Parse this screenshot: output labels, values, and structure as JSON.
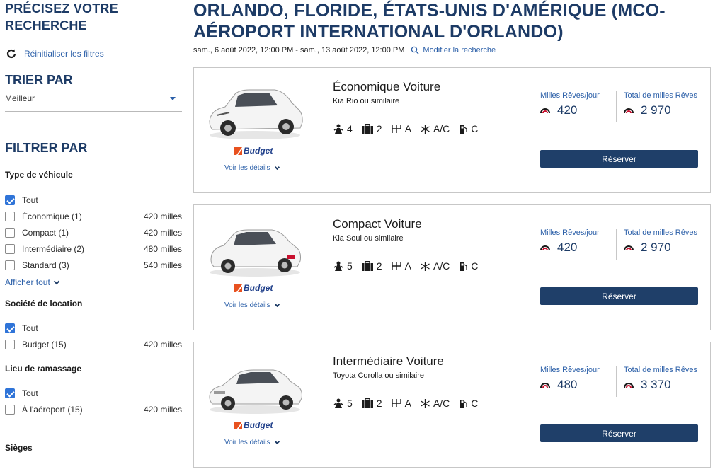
{
  "sidebar": {
    "title_line1": "PRÉCISEZ VOTRE",
    "title_line2": "RECHERCHE",
    "reset_label": "Réinitialiser les filtres",
    "sort_title": "TRIER PAR",
    "sort_value": "Meilleur",
    "filter_title": "FILTRER PAR",
    "vehicle_type": {
      "title": "Type de véhicule",
      "options": [
        {
          "label": "Tout",
          "count": "",
          "checked": true
        },
        {
          "label": "Économique (1)",
          "count": "420 milles",
          "checked": false
        },
        {
          "label": "Compact (1)",
          "count": "420 milles",
          "checked": false
        },
        {
          "label": "Intermédiaire (2)",
          "count": "480 milles",
          "checked": false
        },
        {
          "label": "Standard (3)",
          "count": "540 milles",
          "checked": false
        }
      ],
      "show_all": "Afficher tout"
    },
    "rental_company": {
      "title": "Société de location",
      "options": [
        {
          "label": "Tout",
          "count": "",
          "checked": true
        },
        {
          "label": "Budget (15)",
          "count": "420 milles",
          "checked": false
        }
      ]
    },
    "pickup": {
      "title": "Lieu de ramassage",
      "options": [
        {
          "label": "Tout",
          "count": "",
          "checked": true
        },
        {
          "label": "À l'aéroport (15)",
          "count": "420 milles",
          "checked": false
        }
      ]
    },
    "seats_title": "Sièges"
  },
  "header": {
    "title_line1": "ORLANDO, FLORIDE, ÉTATS-UNIS D'AMÉRIQUE (MCO-",
    "title_line2": "AÉROPORT INTERNATIONAL D'ORLANDO)",
    "dates": "sam., 6 août 2022, 12:00 PM - sam., 13 août 2022, 12:00 PM",
    "modify_label": "Modifier la recherche"
  },
  "common": {
    "brand": "Budget",
    "details_label": "Voir les détails",
    "miles_per_day_label": "Milles Rêves/jour",
    "total_miles_label": "Total de milles Rêves",
    "reserve_label": "Réserver"
  },
  "cars": [
    {
      "name": "Économique Voiture",
      "model": "Kia Rio ou similaire",
      "seats": "4",
      "bags": "2",
      "transmission": "A",
      "ac": "A/C",
      "fuel": "C",
      "per_day": "420",
      "total": "2 970"
    },
    {
      "name": "Compact Voiture",
      "model": "Kia Soul ou similaire",
      "seats": "5",
      "bags": "2",
      "transmission": "A",
      "ac": "A/C",
      "fuel": "C",
      "per_day": "420",
      "total": "2 970"
    },
    {
      "name": "Intermédiaire Voiture",
      "model": "Toyota Corolla ou similaire",
      "seats": "5",
      "bags": "2",
      "transmission": "A",
      "ac": "A/C",
      "fuel": "C",
      "per_day": "480",
      "total": "3 370"
    }
  ],
  "colors": {
    "heading": "#1d3b66",
    "link": "#2b5fa8",
    "button": "#1f3f69",
    "checkbox": "#2f74d8"
  }
}
